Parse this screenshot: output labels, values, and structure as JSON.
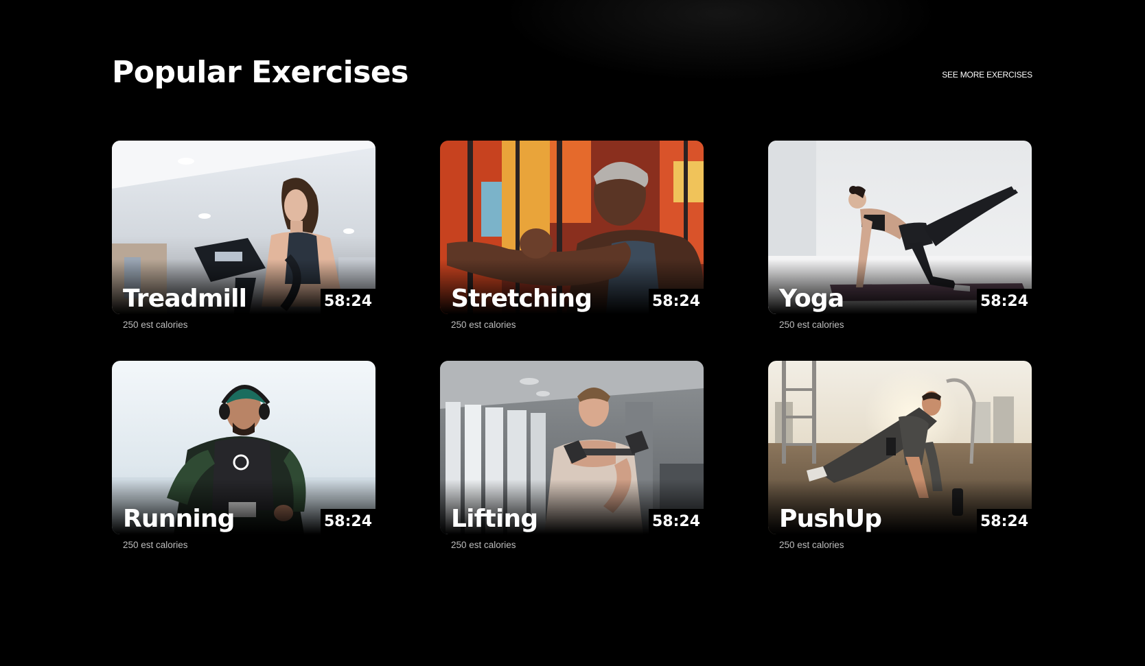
{
  "header": {
    "title": "Popular Exercises",
    "see_more_label": "SEE MORE EXERCISES"
  },
  "exercises": [
    {
      "name": "Treadmill",
      "duration": "58:24",
      "calories": "250 est calories"
    },
    {
      "name": "Stretching",
      "duration": "58:24",
      "calories": "250 est calories"
    },
    {
      "name": "Yoga",
      "duration": "58:24",
      "calories": "250 est calories"
    },
    {
      "name": "Running",
      "duration": "58:24",
      "calories": "250 est calories"
    },
    {
      "name": "Lifting",
      "duration": "58:24",
      "calories": "250 est calories"
    },
    {
      "name": "PushUp",
      "duration": "58:24",
      "calories": "250 est calories"
    }
  ],
  "colors": {
    "background": "#000000",
    "text": "#ffffff",
    "muted_text": "#bdbdbd"
  }
}
